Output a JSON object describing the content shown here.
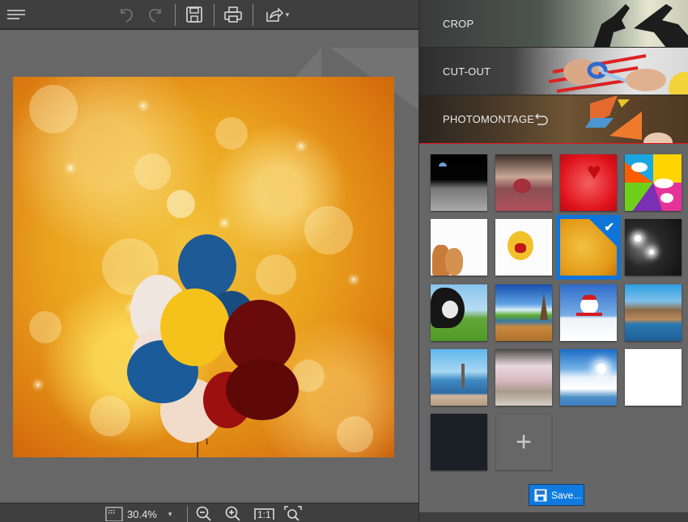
{
  "toolbar": {
    "menu_icon": "hamburger-menu-icon",
    "undo_icon": "undo-icon",
    "redo_icon": "redo-icon",
    "save_icon": "save-icon",
    "print_icon": "print-icon",
    "share_icon": "share-icon",
    "share_dropdown": "▾"
  },
  "statusbar": {
    "zoom_value": "30.4%",
    "zoom_dropdown": "▾",
    "zoom_out_icon": "zoom-out-icon",
    "zoom_in_icon": "zoom-in-icon",
    "actual_size_label": "1:1",
    "fit_icon": "zoom-fit-icon"
  },
  "panel": {
    "sections": [
      {
        "label": "CROP",
        "expanded": false
      },
      {
        "label": "CUT-OUT",
        "expanded": false
      },
      {
        "label": "PHOTOMONTAGE",
        "expanded": true,
        "reset_icon": "reset-icon"
      }
    ],
    "backgrounds": [
      {
        "name": "moon-surface",
        "selected": false
      },
      {
        "name": "heart-tree",
        "selected": false
      },
      {
        "name": "i-love-red",
        "selected": false
      },
      {
        "name": "comic-speech-bubbles",
        "selected": false
      },
      {
        "name": "pets-white",
        "selected": false
      },
      {
        "name": "yellow-monster",
        "selected": false
      },
      {
        "name": "golden-bokeh",
        "selected": true
      },
      {
        "name": "paparazzi-flashes",
        "selected": false
      },
      {
        "name": "cow-meadow",
        "selected": false
      },
      {
        "name": "eiffel-tower-deck",
        "selected": false
      },
      {
        "name": "snowman",
        "selected": false
      },
      {
        "name": "city-skyline",
        "selected": false
      },
      {
        "name": "venice-gondolas",
        "selected": false
      },
      {
        "name": "cherry-blossom-path",
        "selected": false
      },
      {
        "name": "winter-forest",
        "selected": false
      },
      {
        "name": "plain-white",
        "selected": false
      },
      {
        "name": "dark-texture",
        "selected": false
      }
    ],
    "add_label": "+",
    "selected_check": "✔",
    "save_button": "Save..."
  }
}
